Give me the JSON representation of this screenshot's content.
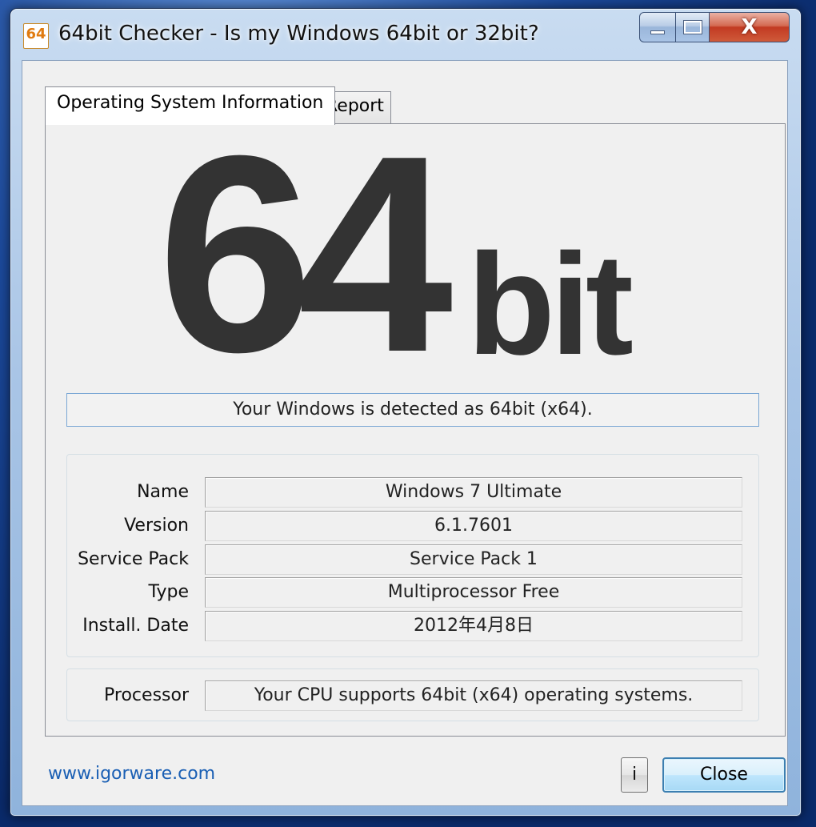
{
  "window": {
    "title": "64bit Checker - Is my Windows 64bit or 32bit?",
    "icon_text": "64",
    "close_glyph": "X"
  },
  "tabs": [
    {
      "label": "Operating System Information",
      "active": true
    },
    {
      "label": "Report",
      "active": false
    }
  ],
  "badge": {
    "number": "64",
    "unit": "bit"
  },
  "detected_text": "Your Windows is detected as 64bit (x64).",
  "os_info": {
    "name_label": "Name",
    "name_value": "Windows 7 Ultimate",
    "version_label": "Version",
    "version_value": "6.1.7601",
    "service_pack_label": "Service Pack",
    "service_pack_value": "Service Pack 1",
    "type_label": "Type",
    "type_value": "Multiprocessor Free",
    "install_date_label": "Install. Date",
    "install_date_value": "2012年4月8日"
  },
  "processor": {
    "label": "Processor",
    "value": "Your CPU supports 64bit (x64) operating systems."
  },
  "footer": {
    "link": "www.igorware.com",
    "info_button": "i",
    "close_button": "Close"
  },
  "colors": {
    "badge_text": "#333333",
    "link": "#1a5fb4",
    "close_caption": "#c23a22"
  }
}
